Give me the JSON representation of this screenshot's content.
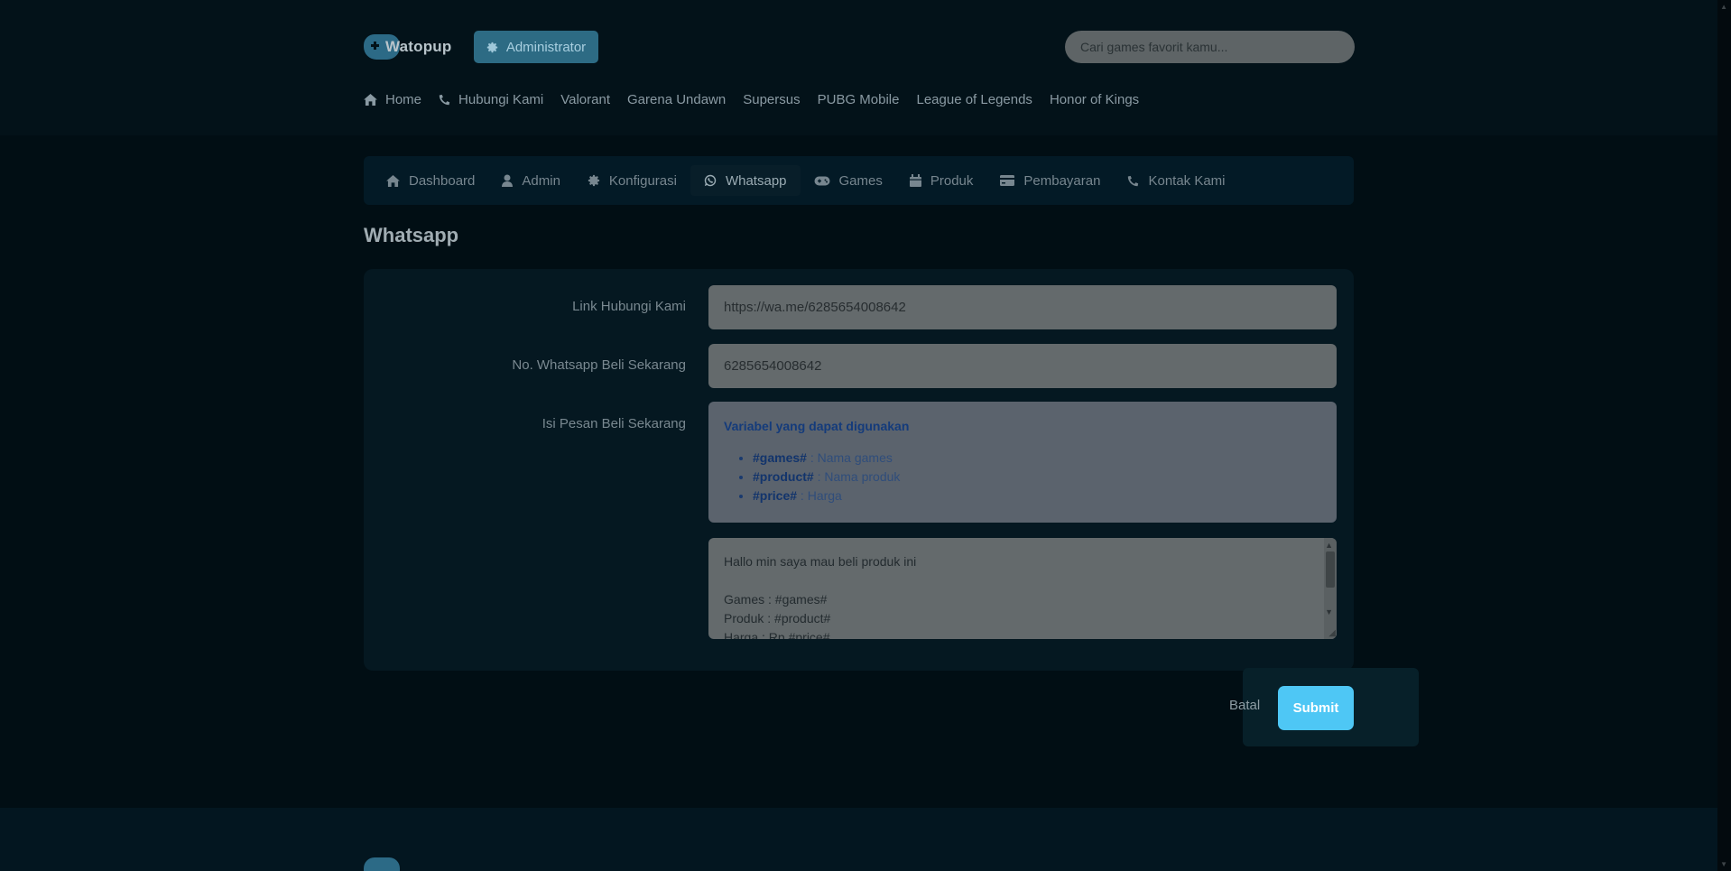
{
  "header": {
    "logo_text": "Watopup",
    "admin_label": "Administrator",
    "search_placeholder": "Cari games favorit kamu..."
  },
  "topnav": [
    {
      "label": "Home",
      "icon": "home-icon"
    },
    {
      "label": "Hubungi Kami",
      "icon": "phone-icon"
    },
    {
      "label": "Valorant"
    },
    {
      "label": "Garena Undawn"
    },
    {
      "label": "Supersus"
    },
    {
      "label": "PUBG Mobile"
    },
    {
      "label": "League of Legends"
    },
    {
      "label": "Honor of Kings"
    }
  ],
  "tabs": [
    {
      "label": "Dashboard",
      "icon": "home-icon"
    },
    {
      "label": "Admin",
      "icon": "user-icon"
    },
    {
      "label": "Konfigurasi",
      "icon": "gear-icon"
    },
    {
      "label": "Whatsapp",
      "icon": "whatsapp-icon",
      "active": true
    },
    {
      "label": "Games",
      "icon": "gamepad-icon"
    },
    {
      "label": "Produk",
      "icon": "box-icon"
    },
    {
      "label": "Pembayaran",
      "icon": "card-icon"
    },
    {
      "label": "Kontak Kami",
      "icon": "phone-icon"
    }
  ],
  "section_title": "Whatsapp",
  "form": {
    "link_label": "Link Hubungi Kami",
    "link_value": "https://wa.me/6285654008642",
    "number_label": "No. Whatsapp Beli Sekarang",
    "number_value": "6285654008642",
    "message_label": "Isi Pesan Beli Sekarang",
    "variables_title": "Variabel yang dapat digunakan",
    "variables": [
      {
        "key": "#games#",
        "desc": " : Nama games"
      },
      {
        "key": "#product#",
        "desc": " : Nama produk"
      },
      {
        "key": "#price#",
        "desc": " : Harga"
      }
    ],
    "message_value": "Hallo min saya mau beli produk ini\n\nGames : #games#\nProduk : #product#\nHarga : Rp #price#"
  },
  "actions": {
    "cancel_label": "Batal",
    "submit_label": "Submit"
  },
  "colors": {
    "accent": "#4ec7f5",
    "admin_button": "#2d6b84",
    "background": "#02121a"
  }
}
